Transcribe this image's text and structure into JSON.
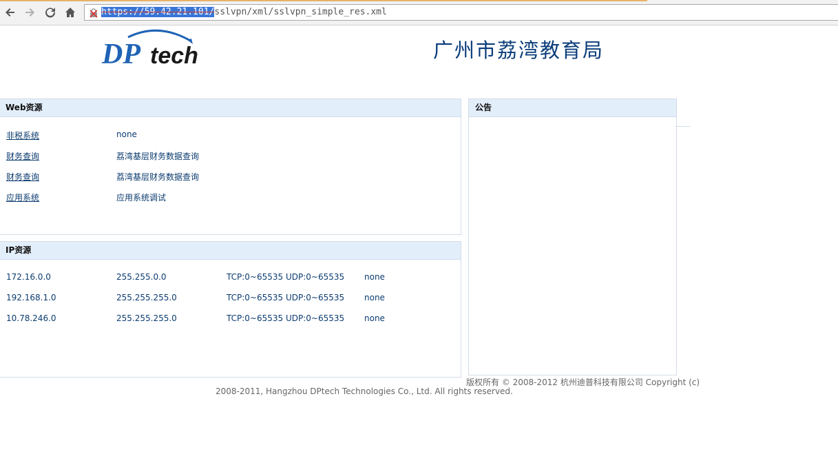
{
  "browser": {
    "url_selected": "https://59.42.21.101/",
    "url_rest": "sslvpn/xml/sslvpn_simple_res.xml",
    "icons": [
      "back-icon",
      "forward-icon",
      "reload-icon",
      "home-icon",
      "insecure-lock-icon"
    ]
  },
  "header": {
    "logo_text": "DPtech",
    "title": "广州市荔湾教育局"
  },
  "web_resources": {
    "heading": "Web资源",
    "items": [
      {
        "name": "非税系统",
        "desc": "none"
      },
      {
        "name": "财务查询",
        "desc": "荔湾基层财务数据查询"
      },
      {
        "name": "财务查询",
        "desc": "荔湾基层财务数据查询"
      },
      {
        "name": "应用系统",
        "desc": "应用系统调试"
      }
    ]
  },
  "ip_resources": {
    "heading": "IP资源",
    "columns": [
      "address",
      "mask",
      "ports",
      "desc"
    ],
    "items": [
      {
        "address": "172.16.0.0",
        "mask": "255.255.0.0",
        "ports": "TCP:0~65535 UDP:0~65535",
        "desc": "none"
      },
      {
        "address": "192.168.1.0",
        "mask": "255.255.255.0",
        "ports": "TCP:0~65535 UDP:0~65535",
        "desc": "none"
      },
      {
        "address": "10.78.246.0",
        "mask": "255.255.255.0",
        "ports": "TCP:0~65535 UDP:0~65535",
        "desc": "none"
      }
    ]
  },
  "notice": {
    "heading": "公告"
  },
  "footer": {
    "line1": "版权所有 © 2008-2012 杭州迪普科技有限公司 Copyright (c)",
    "line2": "2008-2011, Hangzhou DPtech Technologies Co., Ltd. All rights reserved."
  },
  "colors": {
    "panel_header_bg": "#e3eefb",
    "link_text": "#0b3b6f",
    "title_text": "#0b3d7a",
    "logo_blue": "#1f63b5"
  }
}
